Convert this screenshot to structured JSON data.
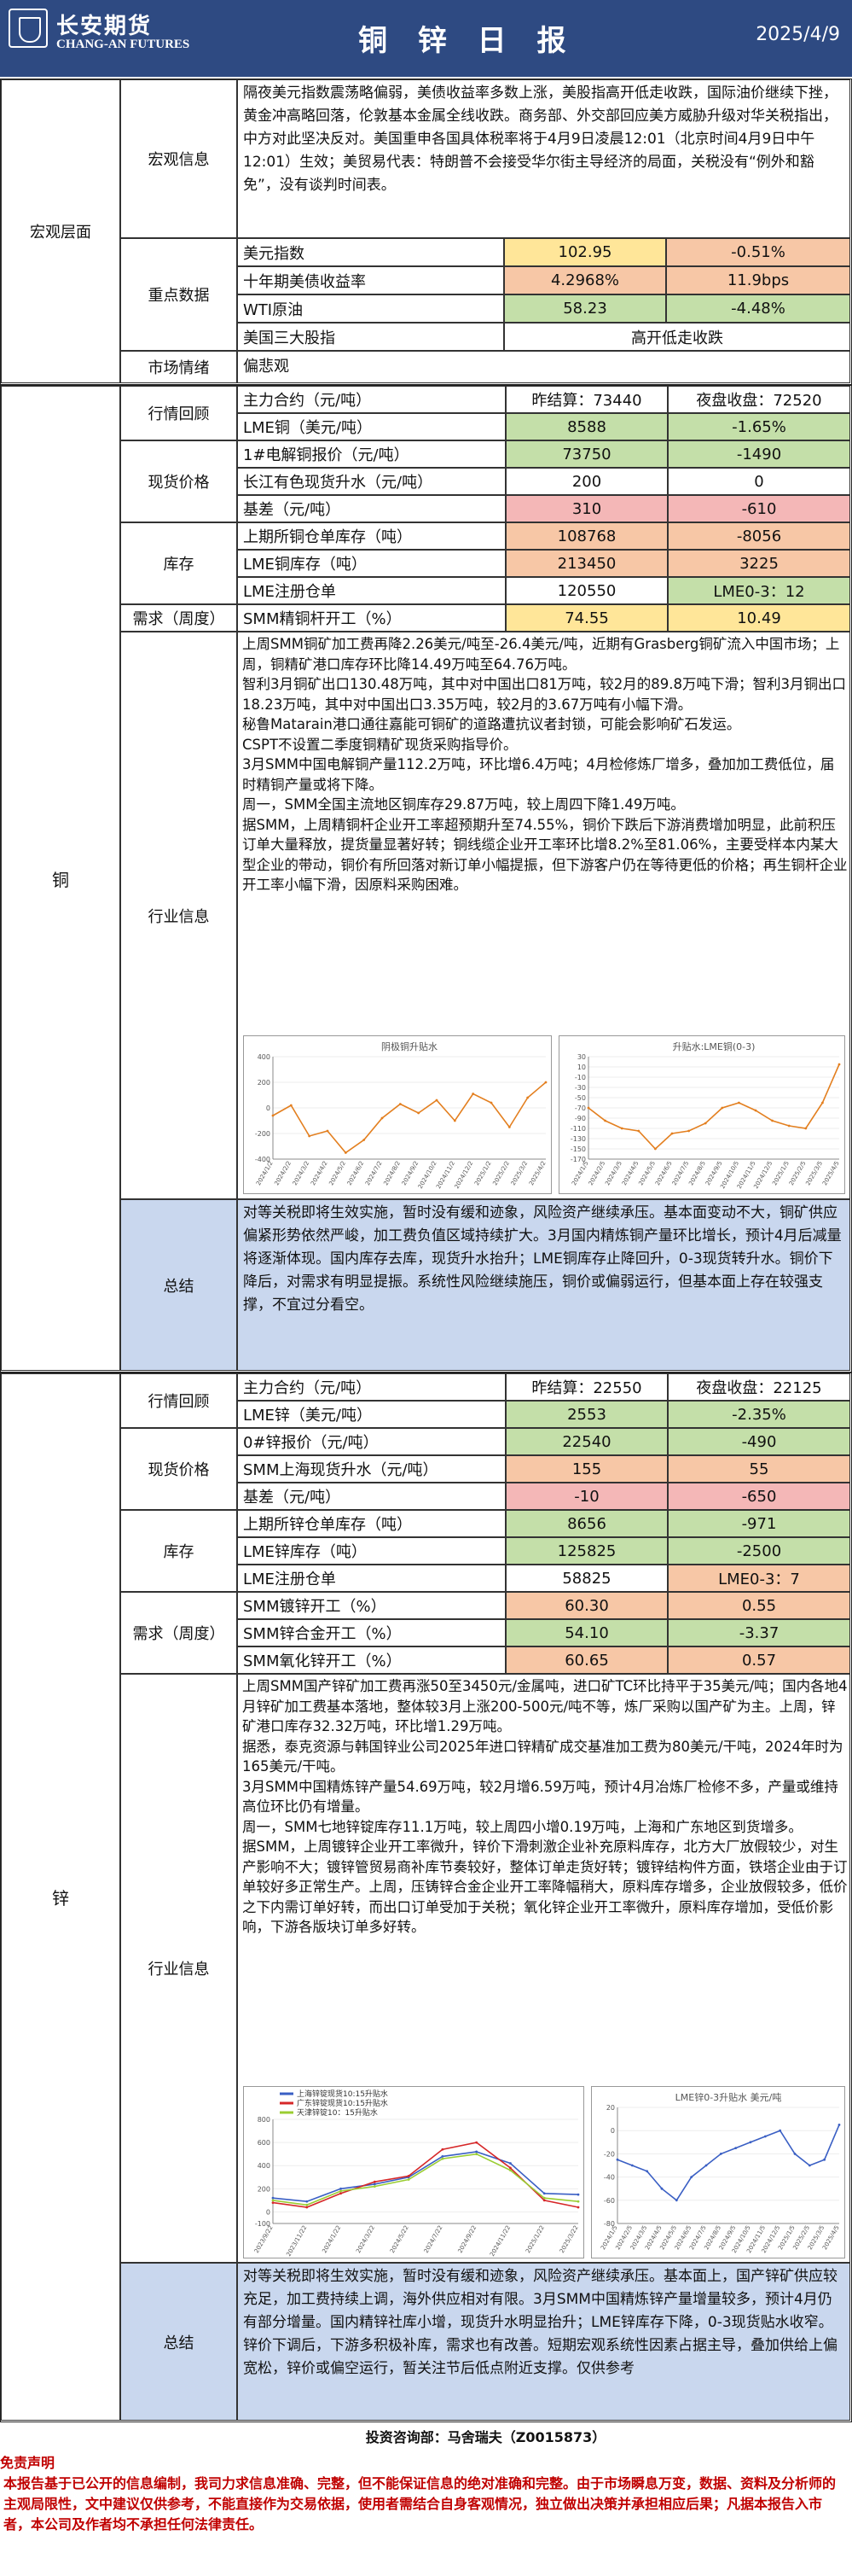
{
  "header": {
    "brand_cn": "长安期货",
    "brand_en": "CHANG-AN FUTURES",
    "title": "铜 锌 日 报",
    "date": "2025/4/9"
  },
  "macro": {
    "section": "宏观层面",
    "info_label": "宏观信息",
    "info_text": "隔夜美元指数震荡略偏弱，美债收益率多数上涨，美股指高开低走收跌，国际油价继续下挫，黄金冲高略回落，伦敦基本金属全线收跌。商务部、外交部回应美方威胁升级对华关税指出，中方对此坚决反对。美国重申各国具体税率将于4月9日凌晨12:01（北京时间4月9日中午12:01）生效；美贸易代表：特朗普不会接受华尔街主导经济的局面，关税没有“例外和豁免”，没有谈判时间表。",
    "key_label": "重点数据",
    "rows": [
      {
        "name": "美元指数",
        "v1": "102.95",
        "v2": "-0.51%"
      },
      {
        "name": "十年期美债收益率",
        "v1": "4.2968%",
        "v2": "11.9bps"
      },
      {
        "name": "WTI原油",
        "v1": "58.23",
        "v2": "-4.48%"
      },
      {
        "name": "美国三大股指",
        "v1": "",
        "v2": "高开低走收跌"
      }
    ],
    "sentiment_label": "市场情绪",
    "sentiment": "偏悲观"
  },
  "copper": {
    "section": "铜",
    "market_label": "行情回顾",
    "market_rows": [
      {
        "name": "主力合约（元/吨）",
        "v1": "昨结算：73440",
        "v2": "夜盘收盘：72520"
      },
      {
        "name": "LME铜（美元/吨）",
        "v1": "8588",
        "v2": "-1.65%"
      }
    ],
    "spot_label": "现货价格",
    "spot_rows": [
      {
        "name": "1#电解铜报价（元/吨）",
        "v1": "73750",
        "v2": "-1490"
      },
      {
        "name": "长江有色现货升水（元/吨）",
        "v1": "200",
        "v2": "0"
      },
      {
        "name": "基差（元/吨）",
        "v1": "310",
        "v2": "-610"
      }
    ],
    "inv_label": "库存",
    "inv_rows": [
      {
        "name": "上期所铜仓单库存（吨）",
        "v1": "108768",
        "v2": "-8056"
      },
      {
        "name": "LME铜库存（吨）",
        "v1": "213450",
        "v2": "3225"
      },
      {
        "name": "LME注册仓单",
        "v1": "120550",
        "v2": "LME0-3：12"
      }
    ],
    "demand_label": "需求（周度）",
    "demand_rows": [
      {
        "name": "SMM精铜杆开工（%）",
        "v1": "74.55",
        "v2": "10.49"
      }
    ],
    "industry_label": "行业信息",
    "industry_paras": [
      "上周SMM铜矿加工费再降2.26美元/吨至-26.4美元/吨，近期有Grasberg铜矿流入中国市场；上周，铜精矿港口库存环比降14.49万吨至64.76万吨。",
      "智利3月铜矿出口130.48万吨，其中对中国出口81万吨，较2月的89.8万吨下滑；智利3月铜出口18.23万吨，其中对中国出口3.35万吨，较2月的3.67万吨有小幅下滑。",
      "秘鲁Matarain港口通往嘉能可铜矿的道路遭抗议者封锁，可能会影响矿石发运。",
      "CSPT不设置二季度铜精矿现货采购指导价。",
      "3月SMM中国电解铜产量112.2万吨，环比增6.4万吨；4月检修炼厂增多，叠加加工费低位，届时精铜产量或将下降。",
      "周一，SMM全国主流地区铜库存29.87万吨，较上周四下降1.49万吨。",
      "据SMM，上周精铜杆企业开工率超预期升至74.55%，铜价下跌后下游消费增加明显，此前积压订单大量释放，提货量显著好转；铜线缆企业开工率环比增8.2%至81.06%，主要受样本内某大型企业的带动，铜价有所回落对新订单小幅提振，但下游客户仍在等待更低的价格；再生铜杆企业开工率小幅下滑，因原料采购困难。"
    ],
    "chart1_title": "阴极铜升贴水",
    "chart1_data": {
      "type": "line",
      "ylim": [
        -400,
        400
      ],
      "yticks": [
        400,
        200,
        0,
        -200,
        -400
      ],
      "x": [
        "2024/1/2",
        "2024/2/2",
        "2024/3/2",
        "2024/4/2",
        "2024/5/2",
        "2024/6/2",
        "2024/7/2",
        "2024/8/2",
        "2024/9/2",
        "2024/10/2",
        "2024/11/2",
        "2024/12/2",
        "2025/1/2",
        "2025/2/2",
        "2025/3/2",
        "2025/4/2"
      ],
      "values": [
        -60,
        20,
        -220,
        -180,
        -350,
        -250,
        -80,
        30,
        -40,
        60,
        -100,
        110,
        40,
        -150,
        80,
        200
      ]
    },
    "chart2_title": "升贴水:LME铜(0-3)",
    "chart2_data": {
      "type": "line",
      "ylim": [
        -170,
        30
      ],
      "yticks": [
        30,
        10,
        -10,
        -30,
        -50,
        -70,
        -90,
        -110,
        -130,
        -150,
        -170
      ],
      "x": [
        "2024/1/5",
        "2024/2/5",
        "2024/3/5",
        "2024/4/5",
        "2024/5/5",
        "2024/6/5",
        "2024/7/5",
        "2024/8/5",
        "2024/9/5",
        "2024/10/5",
        "2024/11/5",
        "2024/12/5",
        "2025/1/5",
        "2025/2/5",
        "2025/3/5",
        "2025/4/5"
      ],
      "values": [
        -70,
        -95,
        -110,
        -115,
        -150,
        -120,
        -115,
        -100,
        -70,
        -60,
        -75,
        -95,
        -105,
        -110,
        -60,
        15
      ]
    },
    "summary_label": "总结",
    "summary": "对等关税即将生效实施，暂时没有缓和迹象，风险资产继续承压。基本面变动不大，铜矿供应偏紧形势依然严峻，加工费负值区域持续扩大。3月国内精炼铜产量环比增长，预计4月后减量将逐渐体现。国内库存去库，现货升水抬升；LME铜库存止降回升，0-3现货转升水。铜价下降后，对需求有明显提振。系统性风险继续施压，铜价或偏弱运行，但基本面上存在较强支撑，不宜过分看空。"
  },
  "zinc": {
    "section": "锌",
    "market_label": "行情回顾",
    "market_rows": [
      {
        "name": "主力合约（元/吨）",
        "v1": "昨结算：22550",
        "v2": "夜盘收盘：22125"
      },
      {
        "name": "LME锌（美元/吨）",
        "v1": "2553",
        "v2": "-2.35%"
      }
    ],
    "spot_label": "现货价格",
    "spot_rows": [
      {
        "name": "0#锌报价（元/吨）",
        "v1": "22540",
        "v2": "-490"
      },
      {
        "name": "SMM上海现货升水（元/吨）",
        "v1": "155",
        "v2": "55"
      },
      {
        "name": "基差（元/吨）",
        "v1": "-10",
        "v2": "-650"
      }
    ],
    "inv_label": "库存",
    "inv_rows": [
      {
        "name": "上期所锌仓单库存（吨）",
        "v1": "8656",
        "v2": "-971"
      },
      {
        "name": "LME锌库存（吨）",
        "v1": "125825",
        "v2": "-2500"
      },
      {
        "name": "LME注册仓单",
        "v1": "58825",
        "v2": "LME0-3：7"
      }
    ],
    "demand_label": "需求（周度）",
    "demand_rows": [
      {
        "name": "SMM镀锌开工（%）",
        "v1": "60.30",
        "v2": "0.55"
      },
      {
        "name": "SMM锌合金开工（%）",
        "v1": "54.10",
        "v2": "-3.37"
      },
      {
        "name": "SMM氧化锌开工（%）",
        "v1": "60.65",
        "v2": "0.57"
      }
    ],
    "industry_label": "行业信息",
    "industry_paras": [
      "上周SMM国产锌矿加工费再涨50至3450元/金属吨，进口矿TC环比持平于35美元/吨；国内各地4月锌矿加工费基本落地，整体较3月上涨200-500元/吨不等，炼厂采购以国产矿为主。上周，锌矿港口库存32.32万吨，环比增1.29万吨。",
      "据悉，泰克资源与韩国锌业公司2025年进口锌精矿成交基准加工费为80美元/干吨，2024年时为165美元/干吨。",
      "3月SMM中国精炼锌产量54.69万吨，较2月增6.59万吨，预计4月冶炼厂检修不多，产量或维持高位环比仍有增量。",
      "周一，SMM七地锌锭库存11.1万吨，较上周四小增0.19万吨，上海和广东地区到货增多。",
      "据SMM，上周镀锌企业开工率微升，锌价下滑刺激企业补充原料库存，北方大厂放假较少，对生产影响不大；镀锌管贸易商补库节奏较好，整体订单走货好转；镀锌结构件方面，铁塔企业由于订单较好多正常生产。上周，压铸锌合金企业开工率降幅稍大，原料库存增多，企业放假较多，低价之下内需订单好转，而出口订单受加于关税；氧化锌企业开工率微升，原料库存增加，受低价影响，下游各版块订单多好转。"
    ],
    "chart1_legend": [
      "上海锌锭现货10:15升贴水",
      "广东锌锭现货10:15升贴水",
      "天津锌锭10：15升贴水"
    ],
    "chart1_colors": [
      "#3a5fc4",
      "#d62728",
      "#9acd32"
    ],
    "chart1_data": {
      "type": "line",
      "ylim": [
        -100,
        800
      ],
      "yticks": [
        800,
        600,
        400,
        200,
        0,
        -100
      ],
      "x": [
        "2023/9/22",
        "2023/11/22",
        "2024/1/22",
        "2024/3/22",
        "2024/5/22",
        "2024/7/22",
        "2024/9/22",
        "2024/11/22",
        "2025/1/22",
        "2025/3/22"
      ],
      "series": [
        {
          "name": "上海锌锭现货10:15升贴水",
          "values": [
            120,
            90,
            200,
            240,
            300,
            480,
            520,
            420,
            160,
            150
          ]
        },
        {
          "name": "广东锌锭现货10:15升贴水",
          "values": [
            80,
            40,
            160,
            260,
            310,
            540,
            600,
            380,
            100,
            40
          ]
        },
        {
          "name": "天津锌锭10：15升贴水",
          "values": [
            100,
            60,
            180,
            220,
            280,
            460,
            500,
            360,
            120,
            90
          ]
        }
      ]
    },
    "chart2_title": "LME锌0-3升贴水 美元/吨",
    "chart2_data": {
      "type": "line",
      "ylim": [
        -80,
        20
      ],
      "yticks": [
        20,
        0,
        -20,
        -40,
        -60,
        -80
      ],
      "x": [
        "2024/1/5",
        "2024/2/5",
        "2024/3/5",
        "2024/4/5",
        "2024/5/5",
        "2024/6/5",
        "2024/7/5",
        "2024/8/5",
        "2024/9/5",
        "2024/10/5",
        "2024/11/5",
        "2024/12/5",
        "2025/1/5",
        "2025/2/5",
        "2025/3/5",
        "2025/4/5"
      ],
      "values": [
        -25,
        -30,
        -35,
        -50,
        -60,
        -40,
        -30,
        -20,
        -15,
        -10,
        -5,
        0,
        -20,
        -30,
        -25,
        5
      ]
    },
    "summary_label": "总结",
    "summary": "对等关税即将生效实施，暂时没有缓和迹象，风险资产继续承压。基本面上，国产锌矿供应较充足，加工费持续上调，海外供应相对有限。3月SMM中国精炼锌产量增量较多，预计4月仍有部分增量。国内精锌社库小增，现货升水明显抬升；LME锌库存下降，0-3现货贴水收窄。锌价下调后，下游多积极补库，需求也有改善。短期宏观系统性因素占据主导，叠加供给上偏宽松，锌价或偏空运行，暂关注节后低点附近支撑。仅供参考"
  },
  "footer": {
    "analyst": "投资咨询部：马舍瑞夫（Z0015873）",
    "disclaimer_title": "免责声明",
    "disclaimer": "本报告基于已公开的信息编制，我司力求信息准确、完整，但不能保证信息的绝对准确和完整。由于市场瞬息万变，数据、资料及分析师的主观局限性，文中建议仅供参考，不能直接作为交易依据，使用者需结合自身客观情况，独立做出决策并承担相应后果；凡据本报告入市者，本公司及作者均不承担任何法律责任。"
  }
}
